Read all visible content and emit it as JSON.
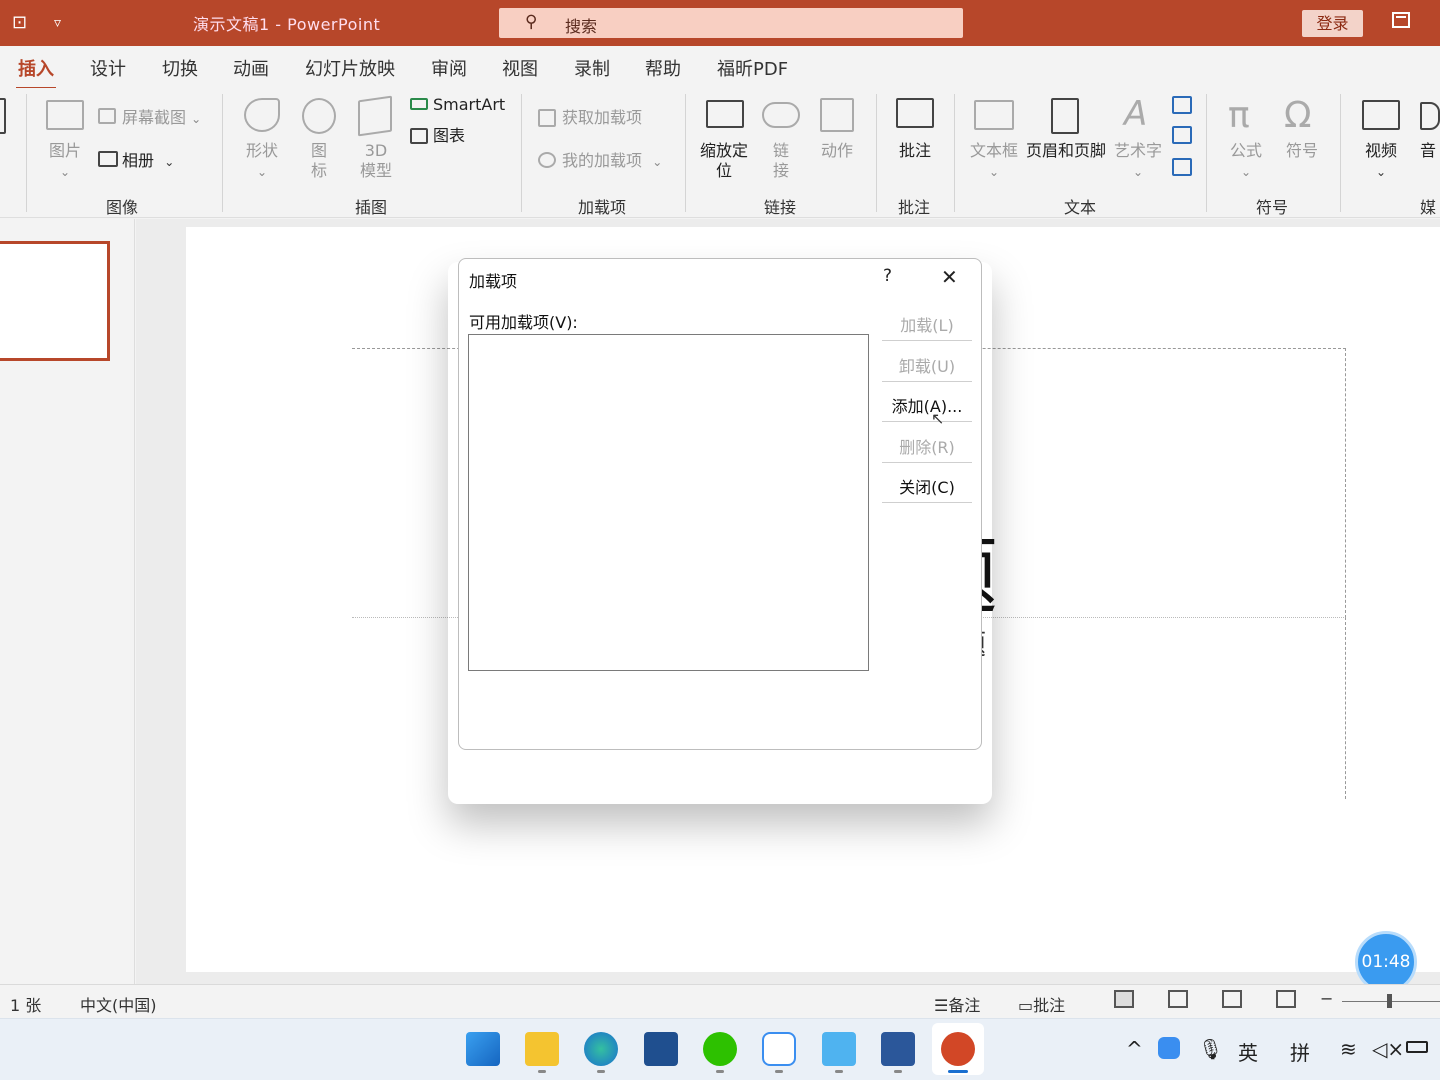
{
  "titlebar": {
    "doc_title": "演示文稿1  -  PowerPoint",
    "search_placeholder": "搜索",
    "login_label": "登录"
  },
  "menu": {
    "tabs": [
      "插入",
      "设计",
      "切换",
      "动画",
      "幻灯片放映",
      "审阅",
      "视图",
      "录制",
      "帮助",
      "福昕PDF"
    ],
    "active_tab": "插入"
  },
  "ribbon": {
    "groups": {
      "image": "图像",
      "illustration": "插图",
      "addins": "加载项",
      "links": "链接",
      "comments": "批注",
      "text": "文本",
      "symbols": "符号",
      "media": "媒"
    },
    "buttons": {
      "picture": "图片",
      "screenshot": "屏幕截图",
      "album": "相册",
      "shapes": "形状",
      "icons": "图\n标",
      "model3d": "3D\n模型",
      "smartart": "SmartArt",
      "chart": "图表",
      "get_addins": "获取加载项",
      "my_addins": "我的加载项",
      "zoom": "缩放定\n位",
      "link": "链\n接",
      "action": "动作",
      "comment": "批注",
      "textbox": "文本框",
      "header_footer": "页眉和页脚",
      "wordart": "艺术字",
      "equation": "公式",
      "symbol": "符号",
      "video": "视频",
      "audio": "音"
    }
  },
  "slide": {
    "title_text": "单击此处添加标题",
    "subtitle_text": "单击此处添加副标题"
  },
  "dialog": {
    "title": "加载项",
    "help": "?",
    "list_label": "可用加载项(V):",
    "buttons": [
      "加载(L)",
      "卸载(U)",
      "添加(A)...",
      "删除(R)",
      "关闭(C)"
    ]
  },
  "timer": "01:48",
  "statusbar": {
    "slide_count": "：1 张",
    "language": "中文(中国)",
    "notes": "备注",
    "comments": "批注"
  },
  "taskbar": {
    "tray_lang1": "英",
    "tray_lang2": "拼"
  },
  "colors": {
    "accent": "#b7472a",
    "title_bar": "#b7472a",
    "search_bg": "#f8cfc2",
    "timer": "#3a9bf0"
  }
}
